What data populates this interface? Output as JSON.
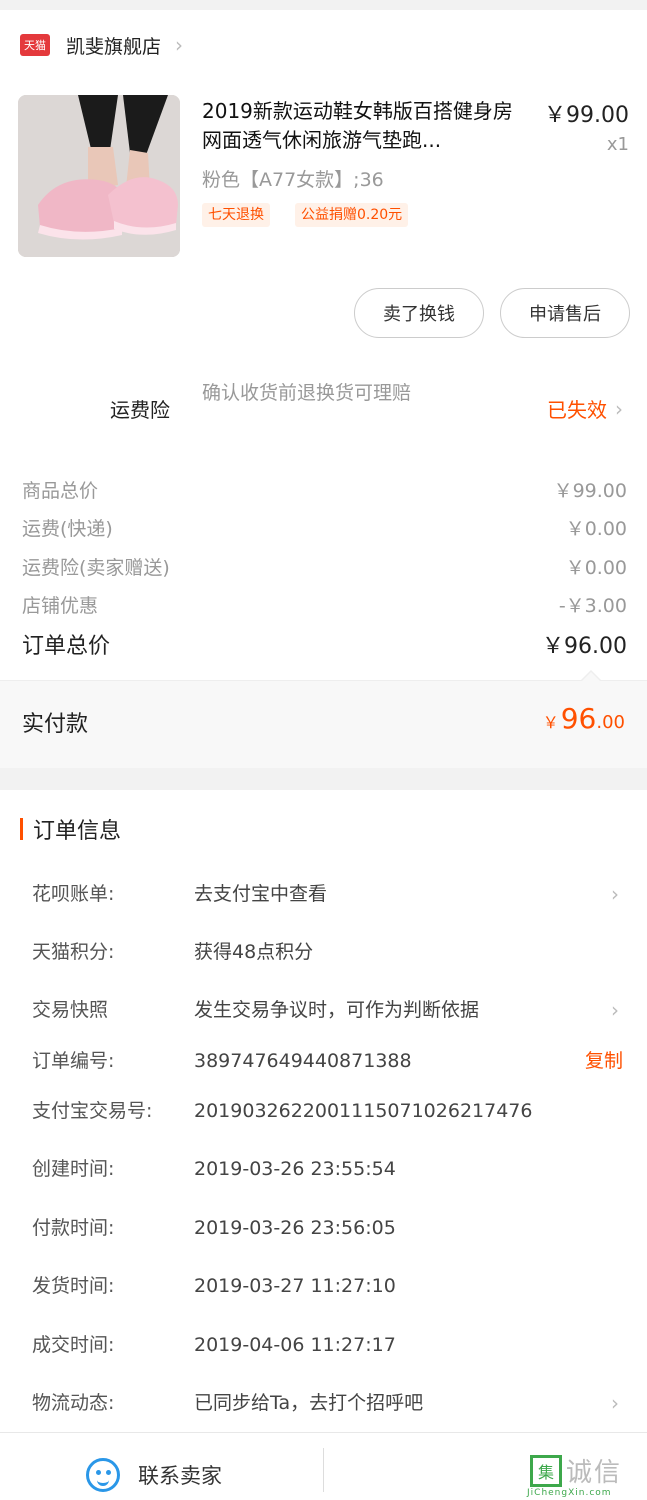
{
  "shop": {
    "badge": "天猫",
    "name": "凯斐旗舰店",
    "chevron_icon": "chevron-right-icon"
  },
  "product": {
    "image_icon": "pink-sneaker-photo",
    "title": "2019新款运动鞋女韩版百搭健身房网面透气休闲旅游气垫跑...",
    "price": "￥99.00",
    "quantity": "x1",
    "sku": "粉色【A77女款】;36",
    "tags": [
      "七天退换",
      "公益捐赠0.20元"
    ]
  },
  "actions": {
    "sell": "卖了换钱",
    "aftersale": "申请售后"
  },
  "insurance": {
    "label": "运费险",
    "desc": "确认收货前退换货可理赔",
    "status": "已失效"
  },
  "summary": {
    "rows": [
      {
        "label": "商品总价",
        "value": "￥99.00"
      },
      {
        "label": "运费(快递)",
        "value": "￥0.00"
      },
      {
        "label": "运费险(卖家赠送)",
        "value": "￥0.00"
      },
      {
        "label": "店铺优惠",
        "value": "-￥3.00"
      }
    ],
    "total_label": "订单总价",
    "total_value": "￥96.00",
    "paid_label": "实付款",
    "paid_currency": "￥",
    "paid_int": "96",
    "paid_dec": ".00"
  },
  "order_info": {
    "title": "订单信息",
    "rows": [
      {
        "label": "花呗账单:",
        "value": "去支付宝中查看"
      },
      {
        "label": "天猫积分:",
        "value": "获得48点积分"
      },
      {
        "label": "交易快照",
        "value": "发生交易争议时，可作为判断依据"
      },
      {
        "label": "订单编号:",
        "value": "389747649440871388"
      },
      {
        "label": "支付宝交易号:",
        "value": "2019032622001115071026217476"
      },
      {
        "label": "创建时间:",
        "value": "2019-03-26 23:55:54"
      },
      {
        "label": "付款时间:",
        "value": "2019-03-26 23:56:05"
      },
      {
        "label": "发货时间:",
        "value": "2019-03-27 11:27:10"
      },
      {
        "label": "成交时间:",
        "value": "2019-04-06 11:27:17"
      },
      {
        "label": "物流动态:",
        "value": "已同步给Ta，去打个招呼吧"
      }
    ],
    "copy_label": "复制"
  },
  "footer": {
    "contact_label": "联系卖家",
    "contact_icon": "smile-chat-icon"
  },
  "watermark": {
    "box_char": "集",
    "text": "诚信",
    "sub": "JiChengXin.com"
  },
  "colors": {
    "accent": "#ff5000",
    "tmall_red": "#e4393c",
    "link_blue": "#2a97e8"
  }
}
